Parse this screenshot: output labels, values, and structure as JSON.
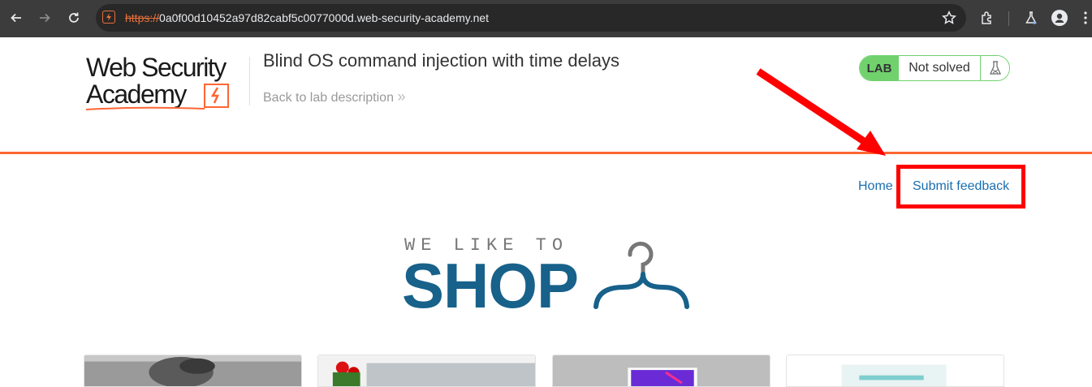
{
  "browser": {
    "url_scheme": "https://",
    "url_rest": "0a0f00d10452a97d82cabf5c0077000d.web-security-academy.net"
  },
  "academy": {
    "logo_line1": "Web Security",
    "logo_line2": "Academy",
    "lab_title": "Blind OS command injection with time delays",
    "back_link": "Back to lab description",
    "back_chevrons": "»",
    "lab_badge": "LAB",
    "lab_status": "Not solved"
  },
  "nav": {
    "home": "Home",
    "submit_feedback": "Submit feedback"
  },
  "shop": {
    "tagline": "WE LIKE TO",
    "name": "SHOP"
  },
  "colors": {
    "brand_orange": "#ff6633",
    "lab_green": "#70d16d",
    "link_blue": "#1a6fb0",
    "shop_blue": "#17618a",
    "annotation_red": "#ff0000"
  }
}
